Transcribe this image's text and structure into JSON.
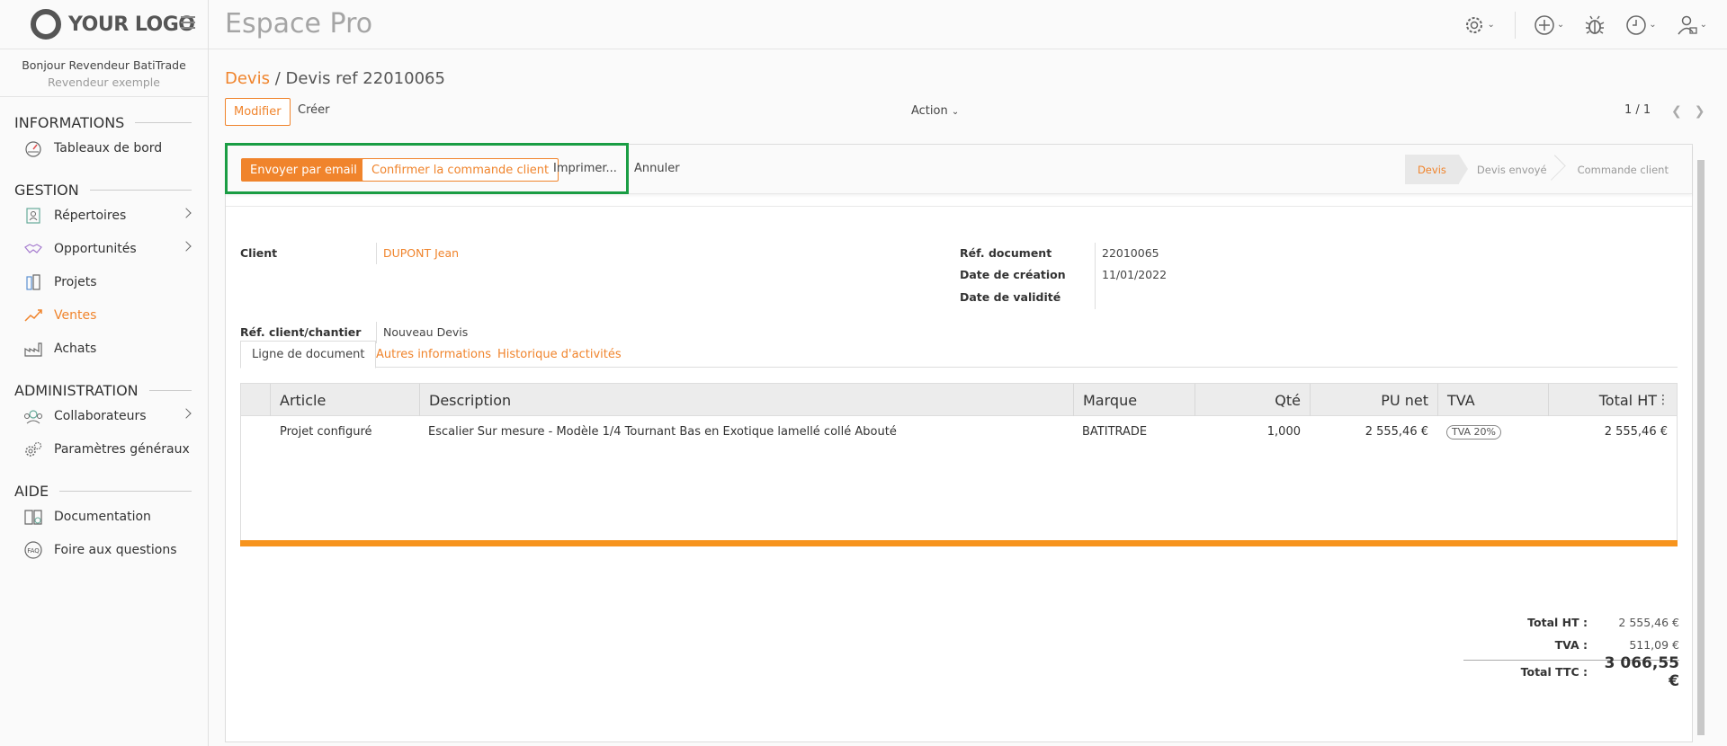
{
  "logo": {
    "text": "YOUR LOGO"
  },
  "app_title": "Espace Pro",
  "user": {
    "greeting": "Bonjour Revendeur BatiTrade",
    "role": "Revendeur exemple"
  },
  "sidebar": {
    "sections": [
      {
        "title": "INFORMATIONS",
        "items": [
          {
            "label": "Tableaux de bord",
            "icon": "dashboard-icon"
          }
        ]
      },
      {
        "title": "GESTION",
        "items": [
          {
            "label": "Répertoires",
            "icon": "contacts-icon",
            "has_children": true
          },
          {
            "label": "Opportunités",
            "icon": "handshake-icon",
            "has_children": true
          },
          {
            "label": "Projets",
            "icon": "projects-icon"
          },
          {
            "label": "Ventes",
            "icon": "sales-chart-icon",
            "active": true
          },
          {
            "label": "Achats",
            "icon": "factory-icon"
          }
        ]
      },
      {
        "title": "ADMINISTRATION",
        "items": [
          {
            "label": "Collaborateurs",
            "icon": "team-icon",
            "has_children": true
          },
          {
            "label": "Paramètres généraux",
            "icon": "settings-gears-icon"
          }
        ]
      },
      {
        "title": "AIDE",
        "items": [
          {
            "label": "Documentation",
            "icon": "book-icon"
          },
          {
            "label": "Foire aux questions",
            "icon": "faq-icon"
          }
        ]
      }
    ]
  },
  "breadcrumb": {
    "parent": "Devis",
    "separator": " / ",
    "current": "Devis ref 22010065"
  },
  "toolbar": {
    "modify": "Modifier",
    "create": "Créer",
    "action": "Action",
    "pager": "1 / 1"
  },
  "statusbar": {
    "send_email": "Envoyer par email",
    "confirm": "Confirmer la commande client",
    "print": "Imprimer...",
    "cancel": "Annuler",
    "steps": [
      "Devis",
      "Devis envoyé",
      "Commande client"
    ]
  },
  "form": {
    "client_label": "Client",
    "client_value": "DUPONT Jean",
    "ref_client_label": "Réf. client/chantier",
    "ref_client_value": "Nouveau Devis",
    "ref_doc_label": "Réf. document",
    "ref_doc_value": "22010065",
    "date_creation_label": "Date de création",
    "date_creation_value": "11/01/2022",
    "date_validite_label": "Date de validité",
    "date_validite_value": ""
  },
  "tabs": [
    "Ligne de document",
    "Autres informations",
    "Historique d'activités"
  ],
  "table": {
    "columns": [
      "Article",
      "Description",
      "Marque",
      "Qté",
      "PU net",
      "TVA",
      "Total HT"
    ],
    "rows": [
      {
        "article": "Projet configuré",
        "description": "Escalier Sur mesure - Modèle 1/4 Tournant Bas en Exotique lamellé collé Abouté",
        "brand": "BATITRADE",
        "qty": "1,000",
        "unit_price": "2 555,46 €",
        "tax": "TVA 20%",
        "total": "2 555,46 €"
      }
    ]
  },
  "totals": {
    "total_ht_label": "Total HT :",
    "total_ht": "2 555,46 €",
    "tva_label": "TVA :",
    "tva": "511,09 €",
    "total_ttc_label": "Total TTC :",
    "total_ttc": "3 066,55 €"
  },
  "colors": {
    "accent": "#f0842c",
    "highlight": "#1a9d44"
  }
}
